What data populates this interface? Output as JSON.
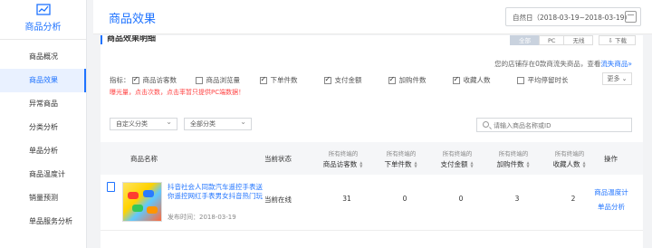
{
  "sidebar": {
    "header": "商品分析",
    "items": [
      {
        "label": "商品概况",
        "active": false
      },
      {
        "label": "商品效果",
        "active": true
      },
      {
        "label": "异常商品",
        "active": false
      },
      {
        "label": "分类分析",
        "active": false
      },
      {
        "label": "单品分析",
        "active": false
      },
      {
        "label": "商品温度计",
        "active": false
      },
      {
        "label": "销量预测",
        "active": false
      },
      {
        "label": "单品服务分析",
        "active": false
      }
    ]
  },
  "header": {
    "title": "商品效果",
    "date_range": "自然日（2018-03-19~2018-03-19）"
  },
  "section": {
    "title": "商品效果明细",
    "segments": [
      "全部",
      "PC",
      "无线"
    ],
    "download": "下载"
  },
  "notice": {
    "prefix": "您的店铺存在0款商流失商品，查看",
    "link": "流失商品»"
  },
  "metrics": {
    "label": "指标：",
    "items": [
      {
        "label": "商品访客数",
        "checked": true
      },
      {
        "label": "商品浏览量",
        "checked": false
      },
      {
        "label": "下单件数",
        "checked": true
      },
      {
        "label": "支付金额",
        "checked": true
      },
      {
        "label": "加购件数",
        "checked": true
      },
      {
        "label": "收藏人数",
        "checked": true
      },
      {
        "label": "平均停留时长",
        "checked": false
      }
    ],
    "more": "更多",
    "warning": "曝光量，点击次数，点击率暂只提供PC端数据！"
  },
  "filters": {
    "custom_category": "自定义分类",
    "all_category": "全部分类",
    "search_placeholder": "请输入商品名称或ID"
  },
  "table": {
    "headers": {
      "name": "商品名称",
      "status": "当前状态",
      "visitors_sub": "所有终端的",
      "visitors": "商品访客数",
      "orders_sub": "所有终端的",
      "orders": "下单件数",
      "payment_sub": "所有终端的",
      "payment": "支付金额",
      "cart_sub": "所有终端的",
      "cart": "加购件数",
      "fav_sub": "所有终端的",
      "fav": "收藏人数",
      "action": "操作"
    },
    "rows": [
      {
        "title": "抖音社会人同款汽车遥控手表送你遥控网红手表男女抖音热门玩",
        "publish_time": "发布时间：2018-03-19",
        "status": "当前在线",
        "visitors": "31",
        "orders": "0",
        "payment": "0",
        "cart": "3",
        "fav": "2",
        "action1": "商品温度计",
        "action2": "单品分析"
      }
    ]
  },
  "colors": {
    "accent": "#1f73ff",
    "warning": "#ff4444"
  }
}
